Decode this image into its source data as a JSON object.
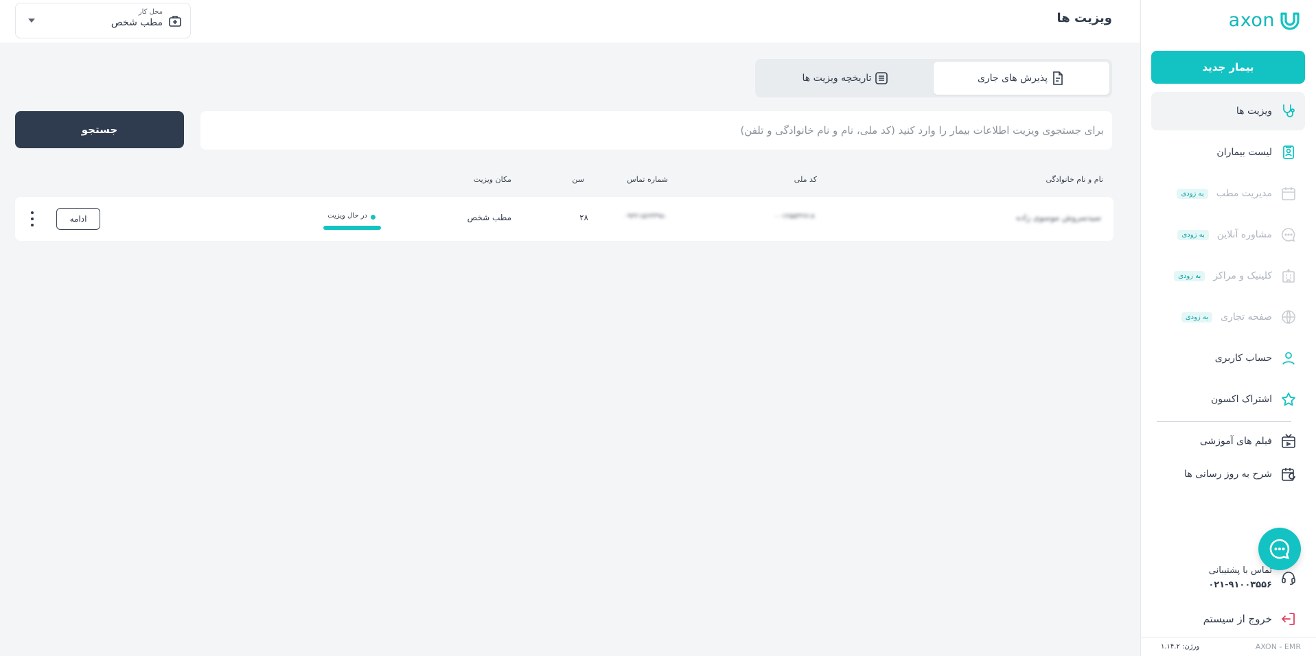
{
  "app": {
    "brand": "axon",
    "footer_brand": "AXON - EMR",
    "version": "ورژن: ۱.۱۴.۲"
  },
  "colors": {
    "accent": "#13c2c2",
    "dark_button": "#2f3c4f",
    "text": "#2f3a4a",
    "background": "#f4f5f7"
  },
  "sidebar": {
    "new_patient_label": "بیمار جدید",
    "soon_badge": "به زودی",
    "items": [
      {
        "label": "ویزیت ها",
        "icon": "stethoscope-icon",
        "active": true,
        "disabled": false
      },
      {
        "label": "لیست بیماران",
        "icon": "patient-list-icon",
        "active": false,
        "disabled": false
      },
      {
        "label": "مدیریت مطب",
        "icon": "calendar-icon",
        "active": false,
        "disabled": true
      },
      {
        "label": "مشاوره آنلاین",
        "icon": "chat-icon",
        "active": false,
        "disabled": true
      },
      {
        "label": "کلینیک و مراکز",
        "icon": "building-icon",
        "active": false,
        "disabled": true
      },
      {
        "label": "صفحه تجاری",
        "icon": "globe-icon",
        "active": false,
        "disabled": true
      },
      {
        "label": "حساب کاربری",
        "icon": "user-icon",
        "active": false,
        "disabled": false
      },
      {
        "label": "اشتراک اکسون",
        "icon": "star-icon",
        "active": false,
        "disabled": false
      },
      {
        "label": "فیلم های آموزشی",
        "icon": "video-icon",
        "active": false,
        "disabled": false
      },
      {
        "label": "شرح به روز رسانی ها",
        "icon": "calendar-refresh-icon",
        "active": false,
        "disabled": false
      }
    ],
    "support_label": "تماس با پشتیبانی",
    "support_phone": "۰۲۱-۹۱۰۰۳۵۵۶",
    "logout_label": "خروج از سیستم"
  },
  "header": {
    "title": "ویزیت ها",
    "workplace_label": "محل کار",
    "workplace_value": "مطب شخص"
  },
  "tabs": [
    {
      "label": "پذیرش های جاری",
      "icon": "document-icon",
      "active": true
    },
    {
      "label": "تاریخچه ویزیت ها",
      "icon": "list-icon",
      "active": false
    }
  ],
  "search": {
    "placeholder": "برای جستجوی ویزیت اطلاعات بیمار را وارد کنید (کد ملی، نام و نام خانوادگی و تلفن)",
    "value": "",
    "button_label": "جستجو"
  },
  "table": {
    "columns": {
      "name": "نام و نام خانوادگی",
      "national_code": "کد ملی",
      "phone": "شماره تماس",
      "age": "سن",
      "location": "مکان ویزیت"
    },
    "rows": [
      {
        "name": "سیدسروش موسوی زاده",
        "national_code": "۰۰۱۲۵۵۳۲۷۱۸",
        "phone": "۰۹۳۲۱۵۶۳۳۹۸۰",
        "age": "۲۸",
        "location": "مطب شخص",
        "status": "در حال ویزیت",
        "action_label": "ادامه"
      }
    ]
  }
}
